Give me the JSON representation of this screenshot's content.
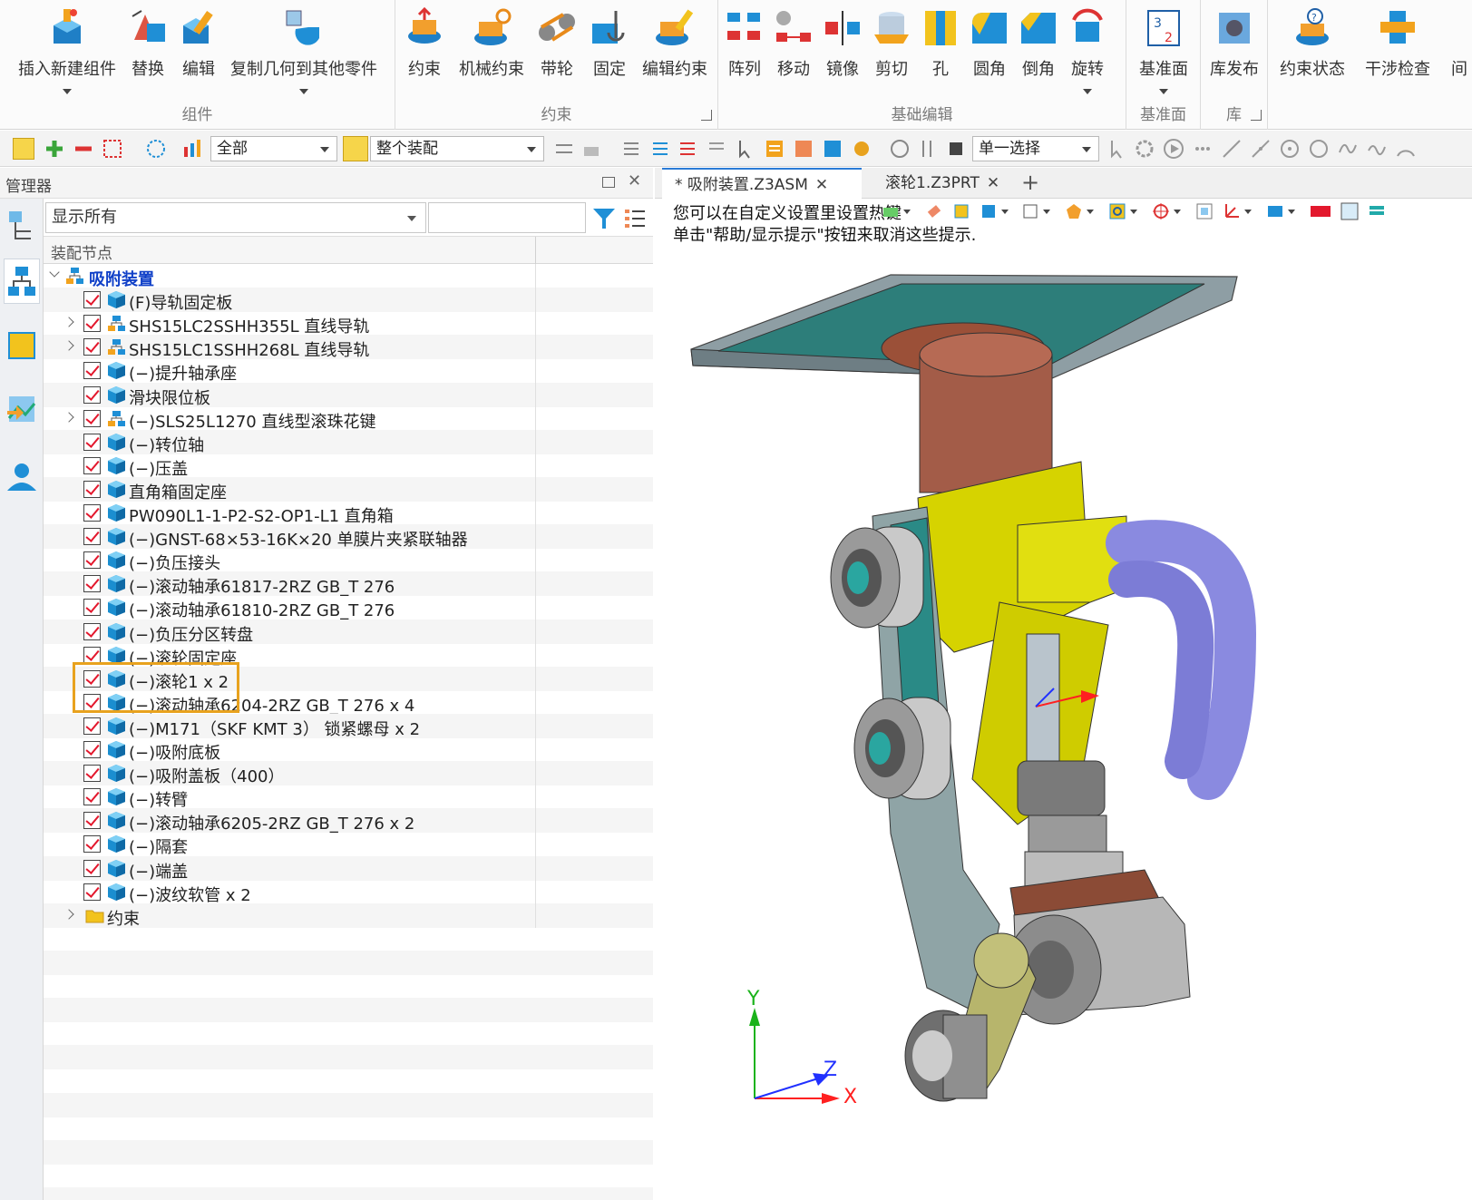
{
  "ribbon": {
    "groups": [
      {
        "label": "组件",
        "buttons": [
          "插入新建组件",
          "替换",
          "编辑",
          "复制几何到其他零件"
        ]
      },
      {
        "label": "约束",
        "buttons": [
          "约束",
          "机械约束",
          "带轮",
          "固定",
          "编辑约束"
        ]
      },
      {
        "label": "基础编辑",
        "buttons": [
          "阵列",
          "移动",
          "镜像",
          "剪切",
          "孔",
          "圆角",
          "倒角",
          "旋转"
        ]
      },
      {
        "label": "基准面",
        "buttons": [
          "基准面"
        ]
      },
      {
        "label": "库",
        "buttons": [
          "库发布"
        ]
      },
      {
        "label": "",
        "buttons": [
          "约束状态",
          "干涉检查",
          "间"
        ]
      }
    ]
  },
  "toolbar": {
    "filter_all": "全部",
    "scope": "整个装配",
    "select_mode": "单一选择"
  },
  "manager": {
    "title": "管理器",
    "filter_value": "显示所有",
    "column_header": "装配节点"
  },
  "tree": {
    "root": "吸附装置",
    "items": [
      {
        "label": "(F)导轨固定板",
        "type": "part",
        "expandable": false
      },
      {
        "label": "SHS15LC2SSHH355L 直线导轨",
        "type": "assembly",
        "expandable": true
      },
      {
        "label": "SHS15LC1SSHH268L 直线导轨",
        "type": "assembly",
        "expandable": true
      },
      {
        "label": "(−)提升轴承座",
        "type": "part",
        "expandable": false
      },
      {
        "label": "滑块限位板",
        "type": "part",
        "expandable": false
      },
      {
        "label": "(−)SLS25L1270 直线型滚珠花键",
        "type": "assembly",
        "expandable": true
      },
      {
        "label": "(−)转位轴",
        "type": "part",
        "expandable": false
      },
      {
        "label": "(−)压盖",
        "type": "part",
        "expandable": false
      },
      {
        "label": "直角箱固定座",
        "type": "part",
        "expandable": false
      },
      {
        "label": "PW090L1-1-P2-S2-OP1-L1 直角箱",
        "type": "part",
        "expandable": false
      },
      {
        "label": "(−)GNST-68×53-16K×20 单膜片夹紧联轴器",
        "type": "part",
        "expandable": false
      },
      {
        "label": "(−)负压接头",
        "type": "part",
        "expandable": false
      },
      {
        "label": "(−)滚动轴承61817-2RZ GB_T 276",
        "type": "part",
        "expandable": false
      },
      {
        "label": "(−)滚动轴承61810-2RZ GB_T 276",
        "type": "part",
        "expandable": false
      },
      {
        "label": "(−)负压分区转盘",
        "type": "part",
        "expandable": false
      },
      {
        "label": "(−)滚轮固定座",
        "type": "part",
        "expandable": false
      },
      {
        "label": "(−)滚轮1 x 2",
        "type": "part",
        "expandable": false
      },
      {
        "label": "(−)滚动轴承6204-2RZ GB_T 276 x 4",
        "type": "part",
        "expandable": false
      },
      {
        "label": "(−)M171（SKF KMT 3） 锁紧螺母 x 2",
        "type": "part",
        "expandable": false
      },
      {
        "label": "(−)吸附底板",
        "type": "part",
        "expandable": false
      },
      {
        "label": "(−)吸附盖板（400）",
        "type": "part",
        "expandable": false
      },
      {
        "label": "(−)转臂",
        "type": "part",
        "expandable": false
      },
      {
        "label": "(−)滚动轴承6205-2RZ GB_T 276 x 2",
        "type": "part",
        "expandable": false
      },
      {
        "label": "(−)隔套",
        "type": "part",
        "expandable": false
      },
      {
        "label": "(−)端盖",
        "type": "part",
        "expandable": false
      },
      {
        "label": "(−)波纹软管 x 2",
        "type": "part",
        "expandable": false
      }
    ],
    "constraints_folder": "约束"
  },
  "doc_tabs": [
    {
      "label": "* 吸附装置.Z3ASM",
      "active": true
    },
    {
      "label": "滚轮1.Z3PRT",
      "active": false
    }
  ],
  "viewport": {
    "hint_line1": "您可以在自定义设置里设置热键",
    "hint_line2": "单击\"帮助/显示提示\"按钮来取消这些提示.",
    "axis_x": "X",
    "axis_y": "Y",
    "axis_z": "Z"
  },
  "colors": {
    "accent": "#2b7bd6",
    "highlight": "#e8a21e",
    "check": "#e3182d",
    "root_text": "#1040c8"
  }
}
